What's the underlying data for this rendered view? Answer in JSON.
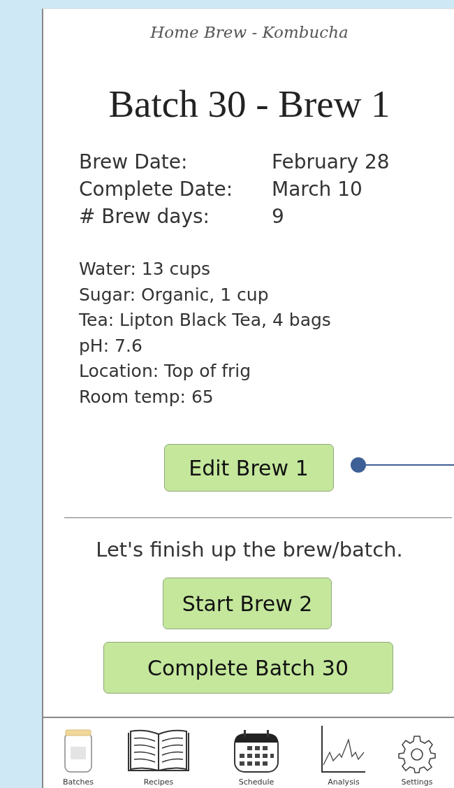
{
  "app_title": "Home Brew - Kombucha",
  "heading": "Batch 30 - Brew 1",
  "dates": [
    {
      "label": "Brew Date:",
      "value": "February 28"
    },
    {
      "label": "Complete Date:",
      "value": "March 10"
    },
    {
      "label": "# Brew days:",
      "value": "9"
    }
  ],
  "details": [
    "Water:  13 cups",
    "Sugar: Organic, 1 cup",
    "Tea: Lipton Black Tea, 4 bags",
    "pH: 7.6",
    "Location: Top of frig",
    "Room temp: 65"
  ],
  "edit_button": "Edit Brew 1",
  "prompt": "Let's finish up the brew/batch.",
  "actions": [
    "Start Brew 2",
    "Complete Batch 30"
  ],
  "nav": [
    {
      "kind": "jar",
      "label": "Batches"
    },
    {
      "kind": "book",
      "label": "Recipes"
    },
    {
      "kind": "calendar",
      "label": "Schedule"
    },
    {
      "kind": "chart",
      "label": "Analysis"
    },
    {
      "kind": "gear",
      "label": "Settings"
    }
  ]
}
